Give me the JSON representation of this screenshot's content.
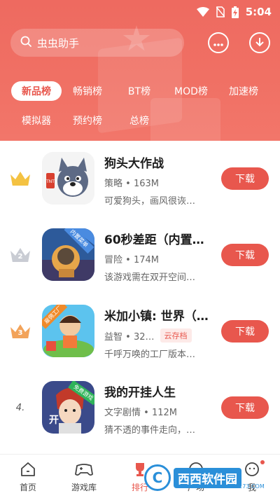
{
  "status_bar": {
    "time": "5:04"
  },
  "search": {
    "placeholder": "虫虫助手"
  },
  "tabs": [
    {
      "label": "新品榜",
      "active": true
    },
    {
      "label": "畅销榜",
      "active": false
    },
    {
      "label": "BT榜",
      "active": false
    },
    {
      "label": "MOD榜",
      "active": false
    },
    {
      "label": "加速榜",
      "active": false
    },
    {
      "label": "模拟器",
      "active": false
    },
    {
      "label": "预约榜",
      "active": false
    },
    {
      "label": "总榜",
      "active": false
    }
  ],
  "apps": [
    {
      "rank": "1",
      "rank_style": "gold",
      "title": "狗头大作战",
      "category": "策略",
      "size": "163M",
      "badge": "",
      "desc": "可爱狗头，画风很诙…",
      "button": "下载",
      "icon_label": ""
    },
    {
      "rank": "2",
      "rank_style": "silver",
      "title": "60秒差距（内置…",
      "category": "冒险",
      "size": "174M",
      "badge": "",
      "desc": "该游戏需在双开空间…",
      "button": "下载",
      "icon_label": "内置菜单"
    },
    {
      "rank": "3",
      "rank_style": "bronze",
      "title": "米加小镇: 世界（…",
      "category": "益智",
      "size": "32…",
      "badge": "云存档",
      "desc": "千呼万唤的工厂版本…",
      "button": "下载",
      "icon_label": "雇佣工厂"
    },
    {
      "rank": "4.",
      "rank_style": "plain",
      "title": "我的开挂人生",
      "category": "文字剧情",
      "size": "112M",
      "badge": "",
      "desc": "猜不透的事件走向，…",
      "button": "下载",
      "icon_label": "免费游戏"
    }
  ],
  "bottom_nav": [
    {
      "label": "首页",
      "icon": "home-icon",
      "active": false
    },
    {
      "label": "游戏库",
      "icon": "gamepad-icon",
      "active": false
    },
    {
      "label": "排行",
      "icon": "trophy-icon",
      "active": true
    },
    {
      "label": "广场",
      "icon": "chat-icon",
      "active": false
    },
    {
      "label": "我",
      "icon": "user-icon",
      "active": false
    }
  ],
  "watermark": {
    "text": "西西软件园",
    "sub": "CR173.COM",
    "logo": "C"
  },
  "colors": {
    "accent": "#e8574d",
    "header": "#ef6c61"
  }
}
